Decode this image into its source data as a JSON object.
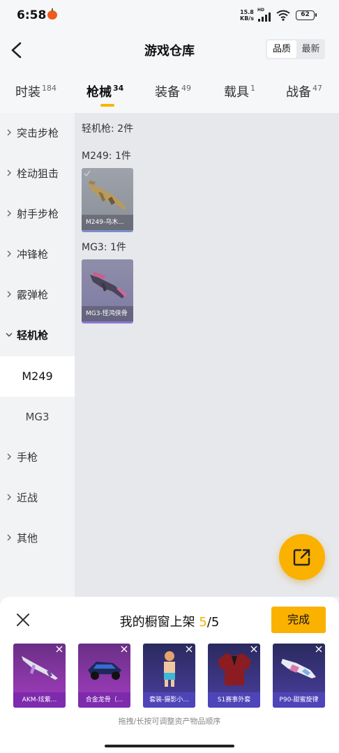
{
  "status_bar": {
    "time": "6:58",
    "net_speed_value": "15.8",
    "net_speed_unit": "KB/s",
    "hd_label": "HD",
    "battery": "62"
  },
  "header": {
    "title": "游戏仓库",
    "sort_options": [
      "品质",
      "最新"
    ],
    "sort_selected": "品质"
  },
  "category_tabs": [
    {
      "label": "时装",
      "count": "184"
    },
    {
      "label": "枪械",
      "count": "34",
      "active": true
    },
    {
      "label": "装备",
      "count": "49"
    },
    {
      "label": "载具",
      "count": "1"
    },
    {
      "label": "战备",
      "count": "47"
    }
  ],
  "sidebar": {
    "items": [
      {
        "label": "突击步枪"
      },
      {
        "label": "栓动狙击"
      },
      {
        "label": "射手步枪"
      },
      {
        "label": "冲锋枪"
      },
      {
        "label": "霰弹枪"
      },
      {
        "label": "轻机枪",
        "expanded": true
      }
    ],
    "subitems": [
      {
        "label": "M249",
        "selected": true
      },
      {
        "label": "MG3"
      }
    ],
    "items_after": [
      {
        "label": "手枪"
      },
      {
        "label": "近战"
      },
      {
        "label": "其他"
      }
    ]
  },
  "content": {
    "summary": "轻机枪: 2件",
    "groups": [
      {
        "heading": "M249: 1件",
        "items": [
          {
            "name": "M249-乌木..."
          }
        ]
      },
      {
        "heading": "MG3: 1件",
        "items": [
          {
            "name": "MG3-怪鸿侠骨"
          }
        ]
      }
    ]
  },
  "showcase": {
    "title_prefix": "我的橱窗上架 ",
    "count_current": "5",
    "count_sep": "/5",
    "done_label": "完成",
    "items": [
      {
        "name": "AKM-炫紫..."
      },
      {
        "name": "合金龙骨（..."
      },
      {
        "name": "套装-摄影小..."
      },
      {
        "name": "S1赛事外套"
      },
      {
        "name": "P90-甜蜜旋律"
      }
    ],
    "hint": "拖拽/长按可调整资产物品顺序"
  },
  "colors": {
    "accent": "#fbb100",
    "selected_bg": "#ffffff",
    "content_bg": "#e7e8eb"
  },
  "icons": {
    "back": "chevron-left-icon",
    "fab": "share-export-icon",
    "close": "close-icon"
  }
}
